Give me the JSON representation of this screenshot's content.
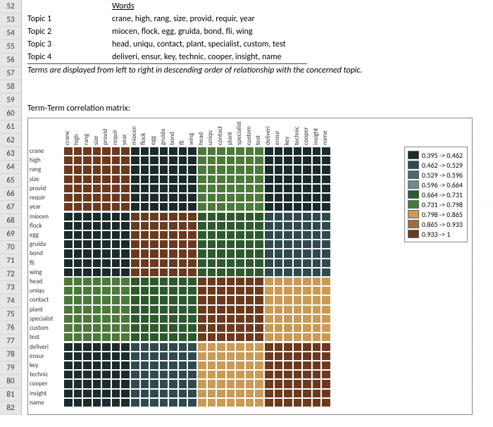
{
  "row_header_start": 52,
  "row_header_count": 31,
  "topics": {
    "header_words": "Words",
    "rows": [
      {
        "label": "Topic 1",
        "words": "crane, high, rang, size, provid, requir, year"
      },
      {
        "label": "Topic 2",
        "words": "miocen, flock, egg, gruida, bond, fli, wing"
      },
      {
        "label": "Topic 3",
        "words": "head, uniqu, contact, plant, specialist, custom, test"
      },
      {
        "label": "Topic 4",
        "words": "deliveri, ensur, key, technic, cooper, insight, name"
      }
    ]
  },
  "note": "Terms are displayed from left to right in descending order of relationship with the concerned topic.",
  "matrix_title": "Term-Term correlation matrix:",
  "terms": [
    "crane",
    "high",
    "rang",
    "size",
    "provid",
    "requir",
    "year",
    "miocen",
    "flock",
    "egg",
    "gruida",
    "bond",
    "fli",
    "wing",
    "head",
    "uniqu",
    "contact",
    "plant",
    "specialist",
    "custom",
    "test",
    "deliveri",
    "ensur",
    "key",
    "technic",
    "cooper",
    "insight",
    "name"
  ],
  "topic_block_sizes": [
    7,
    7,
    7,
    7
  ],
  "topic_matrix": [
    [
      8,
      0,
      5,
      0
    ],
    [
      0,
      8,
      4,
      1
    ],
    [
      5,
      4,
      8,
      6
    ],
    [
      0,
      1,
      6,
      8
    ]
  ],
  "legend": {
    "labels": [
      "0.395 -> 0.462",
      "0.462 -> 0.529",
      "0.529 -> 0.596",
      "0.596 -> 0.664",
      "0.664 -> 0.731",
      "0.731 -> 0.798",
      "0.798 -> 0.865",
      "0.865 -> 0.933",
      "0.933 -> 1"
    ],
    "colors": [
      "#1b2b2b",
      "#2f4a4f",
      "#496b70",
      "#6a8c8f",
      "#2d5a2d",
      "#4c7a3a",
      "#c99b55",
      "#a86a38",
      "#6b3a1e"
    ]
  },
  "chart_data": {
    "type": "heatmap",
    "title": "Term-Term correlation matrix",
    "x": [
      "crane",
      "high",
      "rang",
      "size",
      "provid",
      "requir",
      "year",
      "miocen",
      "flock",
      "egg",
      "gruida",
      "bond",
      "fli",
      "wing",
      "head",
      "uniqu",
      "contact",
      "plant",
      "specialist",
      "custom",
      "test",
      "deliveri",
      "ensur",
      "key",
      "technic",
      "cooper",
      "insight",
      "name"
    ],
    "y": [
      "crane",
      "high",
      "rang",
      "size",
      "provid",
      "requir",
      "year",
      "miocen",
      "flock",
      "egg",
      "gruida",
      "bond",
      "fli",
      "wing",
      "head",
      "uniqu",
      "contact",
      "plant",
      "specialist",
      "custom",
      "test",
      "deliveri",
      "ensur",
      "key",
      "technic",
      "cooper",
      "insight",
      "name"
    ],
    "value_range": [
      0.395,
      1.0
    ],
    "color_bins": [
      0.395,
      0.462,
      0.529,
      0.596,
      0.664,
      0.731,
      0.798,
      0.865,
      0.933,
      1.0
    ],
    "block_structure": {
      "topics": [
        "Topic 1",
        "Topic 2",
        "Topic 3",
        "Topic 4"
      ],
      "sizes": [
        7,
        7,
        7,
        7
      ],
      "approx_block_means": [
        [
          0.97,
          0.43,
          0.7,
          0.43
        ],
        [
          0.43,
          0.97,
          0.66,
          0.5
        ],
        [
          0.7,
          0.66,
          0.97,
          0.8
        ],
        [
          0.43,
          0.5,
          0.8,
          0.97
        ]
      ]
    }
  }
}
